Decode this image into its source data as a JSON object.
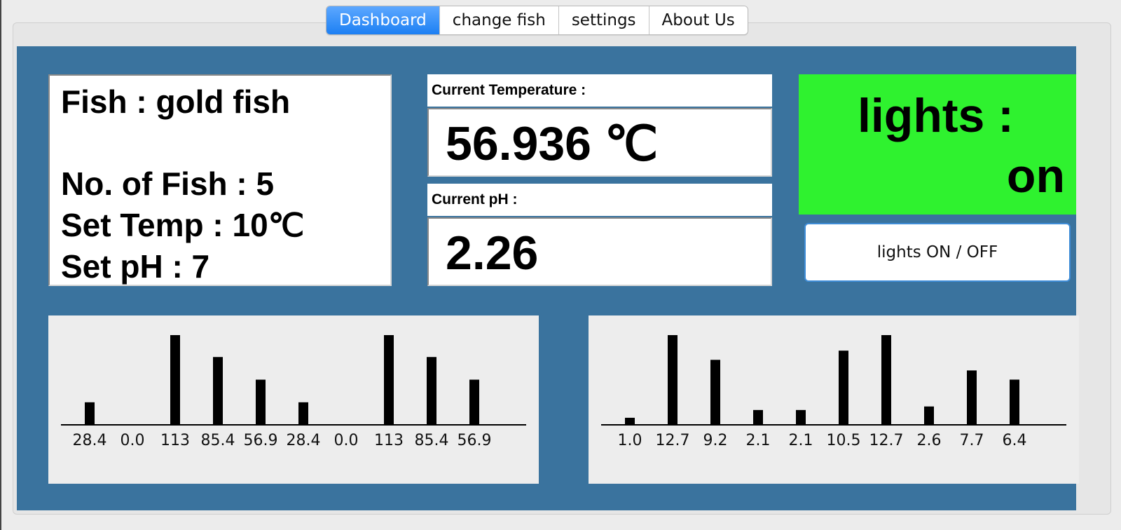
{
  "tabs": [
    {
      "label": "Dashboard",
      "active": true
    },
    {
      "label": "change fish",
      "active": false
    },
    {
      "label": "settings",
      "active": false
    },
    {
      "label": "About Us",
      "active": false
    }
  ],
  "fish_info": {
    "fish": "Fish : gold fish",
    "count": "No. of Fish : 5",
    "set_temp": "Set Temp : 10℃",
    "set_ph": "Set pH : 7"
  },
  "temperature": {
    "label": "Current Temperature :",
    "value": "56.936  ℃"
  },
  "ph": {
    "label": "Current pH :",
    "value": "2.26"
  },
  "lights": {
    "title": "lights :",
    "state": "on",
    "panel_color": "#2ff22f",
    "button_label": "lights ON / OFF"
  },
  "colors": {
    "panel_bg": "#3a739e",
    "tab_active": "#1c7ff3",
    "bar": "#000000"
  },
  "chart_data": [
    {
      "type": "bar",
      "categories": [
        "28.4",
        "0.0",
        "113",
        "85.4",
        "56.9",
        "28.4",
        "0.0",
        "113",
        "85.4",
        "56.9"
      ],
      "values": [
        28.4,
        0.0,
        113,
        85.4,
        56.9,
        28.4,
        0.0,
        113,
        85.4,
        56.9
      ],
      "ylim": [
        0,
        113
      ],
      "grid": false
    },
    {
      "type": "bar",
      "categories": [
        "1.0",
        "12.7",
        "9.2",
        "2.1",
        "2.1",
        "10.5",
        "12.7",
        "2.6",
        "7.7",
        "6.4"
      ],
      "values": [
        1.0,
        12.7,
        9.2,
        2.1,
        2.1,
        10.5,
        12.7,
        2.6,
        7.7,
        6.4
      ],
      "ylim": [
        0,
        12.7
      ],
      "grid": false
    }
  ]
}
